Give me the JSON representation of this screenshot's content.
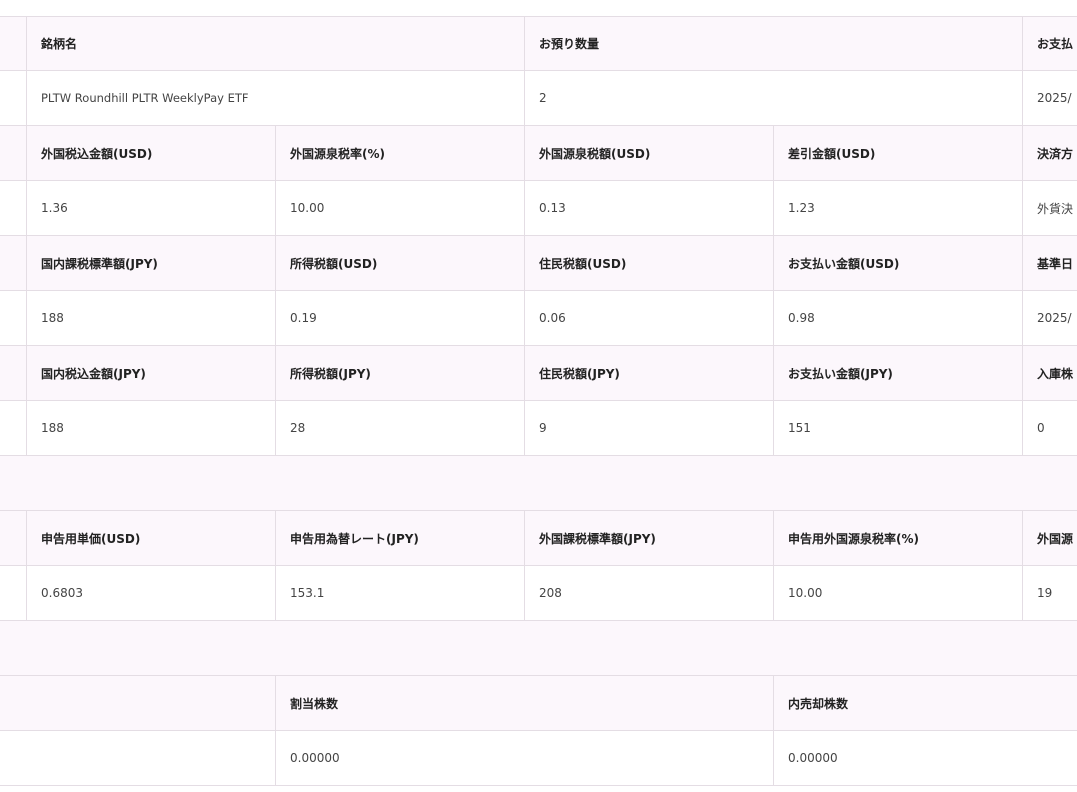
{
  "section1": {
    "header": {
      "name": "銘柄名",
      "quantity": "お預り数量",
      "payment_date": "お支払"
    },
    "row": {
      "name": "PLTW Roundhill PLTR WeeklyPay ETF",
      "quantity": "2",
      "payment_date": "2025/"
    }
  },
  "section2": {
    "header": [
      "外国税込金額(USD)",
      "外国源泉税率(%)",
      "外国源泉税額(USD)",
      "差引金額(USD)",
      "決済方"
    ],
    "row": [
      "1.36",
      "10.00",
      "0.13",
      "1.23",
      "外貨決"
    ]
  },
  "section3": {
    "header": [
      "国内課税標準額(JPY)",
      "所得税額(USD)",
      "住民税額(USD)",
      "お支払い金額(USD)",
      "基準日"
    ],
    "row": [
      "188",
      "0.19",
      "0.06",
      "0.98",
      "2025/"
    ]
  },
  "section4": {
    "header": [
      "国内税込金額(JPY)",
      "所得税額(JPY)",
      "住民税額(JPY)",
      "お支払い金額(JPY)",
      "入庫株"
    ],
    "row": [
      "188",
      "28",
      "9",
      "151",
      "0"
    ]
  },
  "section5": {
    "header": [
      "申告用単価(USD)",
      "申告用為替レート(JPY)",
      "外国課税標準額(JPY)",
      "申告用外国源泉税率(%)",
      "外国源"
    ],
    "row": [
      "0.6803",
      "153.1",
      "208",
      "10.00",
      "19"
    ]
  },
  "section6": {
    "header": [
      "割当株数",
      "内売却株数"
    ],
    "row": [
      "0.00000",
      "0.00000"
    ]
  }
}
